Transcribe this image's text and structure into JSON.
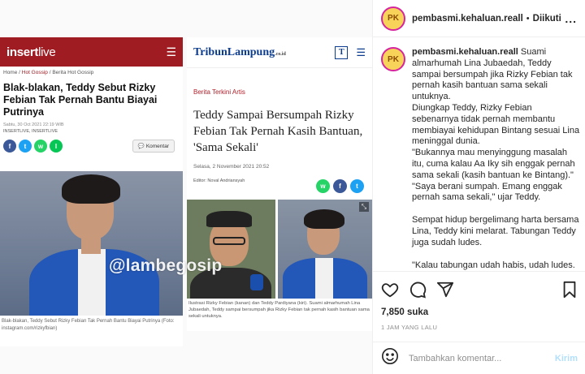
{
  "media": {
    "article_left": {
      "logo_main": "insert",
      "logo_suffix": "live",
      "menu_icon": "hamburger-icon",
      "breadcrumb": [
        "Home",
        "Hot Gossip",
        "Berita Hot Gossip"
      ],
      "breadcrumb_sep": " / ",
      "title": "Blak-blakan, Teddy Sebut Rizky Febian Tak Pernah Bantu Biayai Putrinya",
      "date": "Sabtu, 30 Oct 2021 22:19 WIB",
      "source": "INSERTLIVE, INSERTLIVE",
      "share": [
        "f",
        "t",
        "w",
        "l"
      ],
      "comment_label": "Komentar",
      "photo_caption": "Blak-blakan, Teddy Sebut Rizky Febian Tak Pernah Bantu Biayai Putrinya (Foto: instagram.com/rizkyfbian)"
    },
    "article_right": {
      "logo": "TribunLampung",
      "logo_suffix": ".co.id",
      "badge": "T",
      "category": "Berita Terkini Artis",
      "title": "Teddy Sampai Bersumpah Rizky Febian Tak Pernah Kasih Bantuan, 'Sama Sekali'",
      "date": "Selasa, 2 November 2021 20:52",
      "editor": "Editor: Noval Andriansyah",
      "share": [
        "w",
        "f",
        "t"
      ],
      "photo_caption": "Ilustrasi Rizky Febian (kanan) dan Teddy Pardiyana (kiri). Suami almarhumah Lina Jubaedah, Teddy sampai bersumpah jika Rizky Febian tak pernah kasih bantuan sama sekali untuknya."
    },
    "watermark": "@lambegosip"
  },
  "post": {
    "username": "pembasmi.kehaluan.reall",
    "dot": "•",
    "follow_status": "Diikuti",
    "more": "...",
    "avatar_label": "PK",
    "caption_user": "pembasmi.kehaluan.reall",
    "caption_lines": [
      "Suami almarhumah Lina Jubaedah, Teddy sampai bersumpah jika Rizky Febian tak pernah kasih bantuan sama sekali untuknya.",
      "Diungkap Teddy, Rizky Febian sebenarnya tidak pernah membantu membiayai kehidupan Bintang sesuai Lina meninggal dunia.",
      "\"Bukannya mau menyinggung masalah itu, cuma kalau Aa Iky sih enggak pernah sama sekali (kasih bantuan ke Bintang).\"",
      "\"Saya berani sumpah. Emang enggak pernah sama sekali,\" ujar Teddy.",
      "Sempat hidup bergelimang harta bersama Lina, Teddy kini melarat. Tabungan Teddy juga sudah ludes.",
      "\"Kalau tabungan udah habis, udah ludes."
    ],
    "likes": "7,850 suka",
    "time_ago": "1 JAM YANG LALU",
    "comment_placeholder": "Tambahkan komentar...",
    "post_button": "Kirim"
  }
}
